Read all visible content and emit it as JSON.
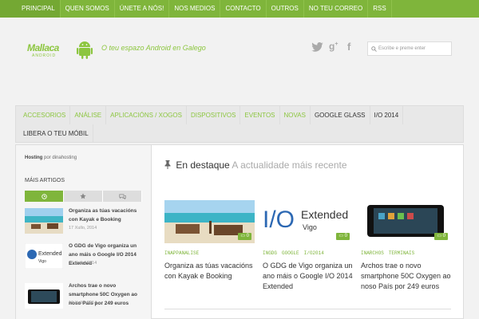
{
  "topnav": [
    "PRINCIPAL",
    "QUEN SOMOS",
    "ÚNETE A NÓS!",
    "NOS MEDIOS",
    "CONTACTO",
    "OUTROS",
    "NO TEU CORREO",
    "RSS"
  ],
  "header": {
    "logo_text": "Mallaca",
    "logo_sub": "ANDROID",
    "tagline": "O teu espazo Android en Galego",
    "social": [
      "twitter-icon",
      "google-plus-icon",
      "facebook-icon"
    ],
    "search_placeholder": "Escribe e preme enter"
  },
  "categories_row1": [
    "ACCESORIOS",
    "ANÁLISE",
    "APLICACIÓNS / XOGOS",
    "DISPOSITIVOS",
    "EVENTOS",
    "NOVAS",
    "GOOGLE GLASS",
    "I/O 2014"
  ],
  "categories_row2": [
    "LIBERA O TEU MÓBIL"
  ],
  "sidebar": {
    "sponsor_name": "Hosting",
    "sponsor_text": " por dinahosting",
    "heading": "MÁIS ARTIGOS",
    "tabs": [
      "clock-icon",
      "star-icon",
      "comments-icon"
    ],
    "items": [
      {
        "title": "Organiza as túas vacacións con Kayak e Booking",
        "date": "17 Xullo, 2014"
      },
      {
        "title": "O GDG de Vigo organiza un ano máis o Google I/O 2014 Extended",
        "date": "16 Xullo, 2014"
      },
      {
        "title": "Archos trae o novo smartphone 50C Oxygen ao noso País por 249 euros",
        "date": "16 Xullo, 2014"
      }
    ]
  },
  "featured": {
    "title": "En destaque",
    "subtitle": "A actualidade máis recente",
    "cards": [
      {
        "tags": [
          "INAPPANALISE"
        ],
        "comments": "0",
        "title": "Organiza as túas vacacións con Kayak e Booking"
      },
      {
        "tags": [
          "INGDG",
          "GOOGLE",
          "I/O2014"
        ],
        "comments": "0",
        "title": "O GDG de Vigo organiza un ano máis o Google I/O 2014 Extended",
        "img_text": "Extended",
        "img_sub": "Vigo"
      },
      {
        "tags": [
          "INARCHOS",
          "TERMINAIS"
        ],
        "comments": "0",
        "title": "Archos trae o novo smartphone 50C Oxygen ao noso País por 249 euros"
      }
    ]
  },
  "colors": {
    "accent": "#7fb53b",
    "logo": "#8cc63f"
  }
}
